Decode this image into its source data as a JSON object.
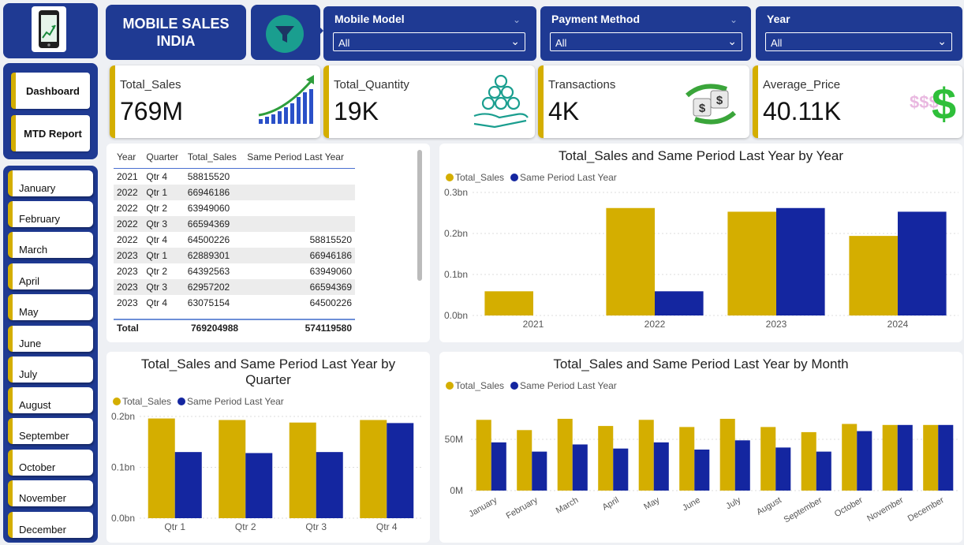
{
  "header": {
    "title_line1": "MOBILE SALES",
    "title_line2": "INDIA"
  },
  "nav": {
    "dashboard_label": "Dashboard",
    "mtd_label": "MTD Report"
  },
  "months": [
    "January",
    "February",
    "March",
    "April",
    "May",
    "June",
    "July",
    "August",
    "September",
    "October",
    "November",
    "December"
  ],
  "slicers": [
    {
      "title": "Mobile Model",
      "value": "All"
    },
    {
      "title": "Payment Method",
      "value": "All"
    },
    {
      "title": "Year",
      "value": "All"
    }
  ],
  "kpis": [
    {
      "label": "Total_Sales",
      "value": "769M",
      "icon": "growth-bar-chart-icon"
    },
    {
      "label": "Total_Quantity",
      "value": "19K",
      "icon": "coins-in-hand-icon"
    },
    {
      "label": "Transactions",
      "value": "4K",
      "icon": "money-exchange-icon"
    },
    {
      "label": "Average_Price",
      "value": "40.11K",
      "icon": "dollar-sign-icon"
    }
  ],
  "table": {
    "headers": [
      "Year",
      "Quarter",
      "Total_Sales",
      "Same Period Last Year"
    ],
    "rows": [
      [
        "2021",
        "Qtr 4",
        "58815520",
        ""
      ],
      [
        "2022",
        "Qtr 1",
        "66946186",
        ""
      ],
      [
        "2022",
        "Qtr 2",
        "63949060",
        ""
      ],
      [
        "2022",
        "Qtr 3",
        "66594369",
        ""
      ],
      [
        "2022",
        "Qtr 4",
        "64500226",
        "58815520"
      ],
      [
        "2023",
        "Qtr 1",
        "62889301",
        "66946186"
      ],
      [
        "2023",
        "Qtr 2",
        "64392563",
        "63949060"
      ],
      [
        "2023",
        "Qtr 3",
        "62957202",
        "66594369"
      ],
      [
        "2023",
        "Qtr 4",
        "63075154",
        "64500226"
      ]
    ],
    "total_label": "Total",
    "total_sales": "769204988",
    "total_last_year": "574119580"
  },
  "colors": {
    "navy": "#1f3a93",
    "gold": "#d4ae00",
    "bar_blue": "#1426a0"
  },
  "legend": {
    "total": "Total_Sales",
    "last": "Same Period Last Year"
  },
  "chart_data": [
    {
      "type": "bar",
      "title": "Total_Sales and Same Period Last Year by Year",
      "categories": [
        "2021",
        "2022",
        "2023",
        "2024"
      ],
      "series": [
        {
          "name": "Total_Sales",
          "values": [
            0.059,
            0.262,
            0.253,
            0.194
          ]
        },
        {
          "name": "Same Period Last Year",
          "values": [
            0,
            0.059,
            0.262,
            0.253
          ]
        }
      ],
      "yticks": [
        "0.0bn",
        "0.1bn",
        "0.2bn",
        "0.3bn"
      ],
      "ylim": [
        0,
        0.3
      ],
      "unit": "bn"
    },
    {
      "type": "bar",
      "title_line1": "Total_Sales and Same Period Last Year by",
      "title_line2": "Quarter",
      "categories": [
        "Qtr 1",
        "Qtr 2",
        "Qtr 3",
        "Qtr 4"
      ],
      "series": [
        {
          "name": "Total_Sales",
          "values": [
            0.196,
            0.193,
            0.188,
            0.193
          ]
        },
        {
          "name": "Same Period Last Year",
          "values": [
            0.13,
            0.128,
            0.13,
            0.187
          ]
        }
      ],
      "yticks": [
        "0.0bn",
        "0.1bn",
        "0.2bn"
      ],
      "ylim": [
        0,
        0.2
      ],
      "unit": "bn"
    },
    {
      "type": "bar",
      "title": "Total_Sales and Same Period Last Year by Month",
      "categories": [
        "January",
        "February",
        "March",
        "April",
        "May",
        "June",
        "July",
        "August",
        "September",
        "October",
        "November",
        "December"
      ],
      "series": [
        {
          "name": "Total_Sales",
          "values": [
            69,
            59,
            70,
            63,
            69,
            62,
            70,
            62,
            57,
            65,
            64,
            64
          ]
        },
        {
          "name": "Same Period Last Year",
          "values": [
            47,
            38,
            45,
            41,
            47,
            40,
            49,
            42,
            38,
            58,
            64,
            64
          ]
        }
      ],
      "yticks": [
        "0M",
        "50M"
      ],
      "ylim": [
        0,
        80
      ],
      "unit": "M"
    }
  ]
}
